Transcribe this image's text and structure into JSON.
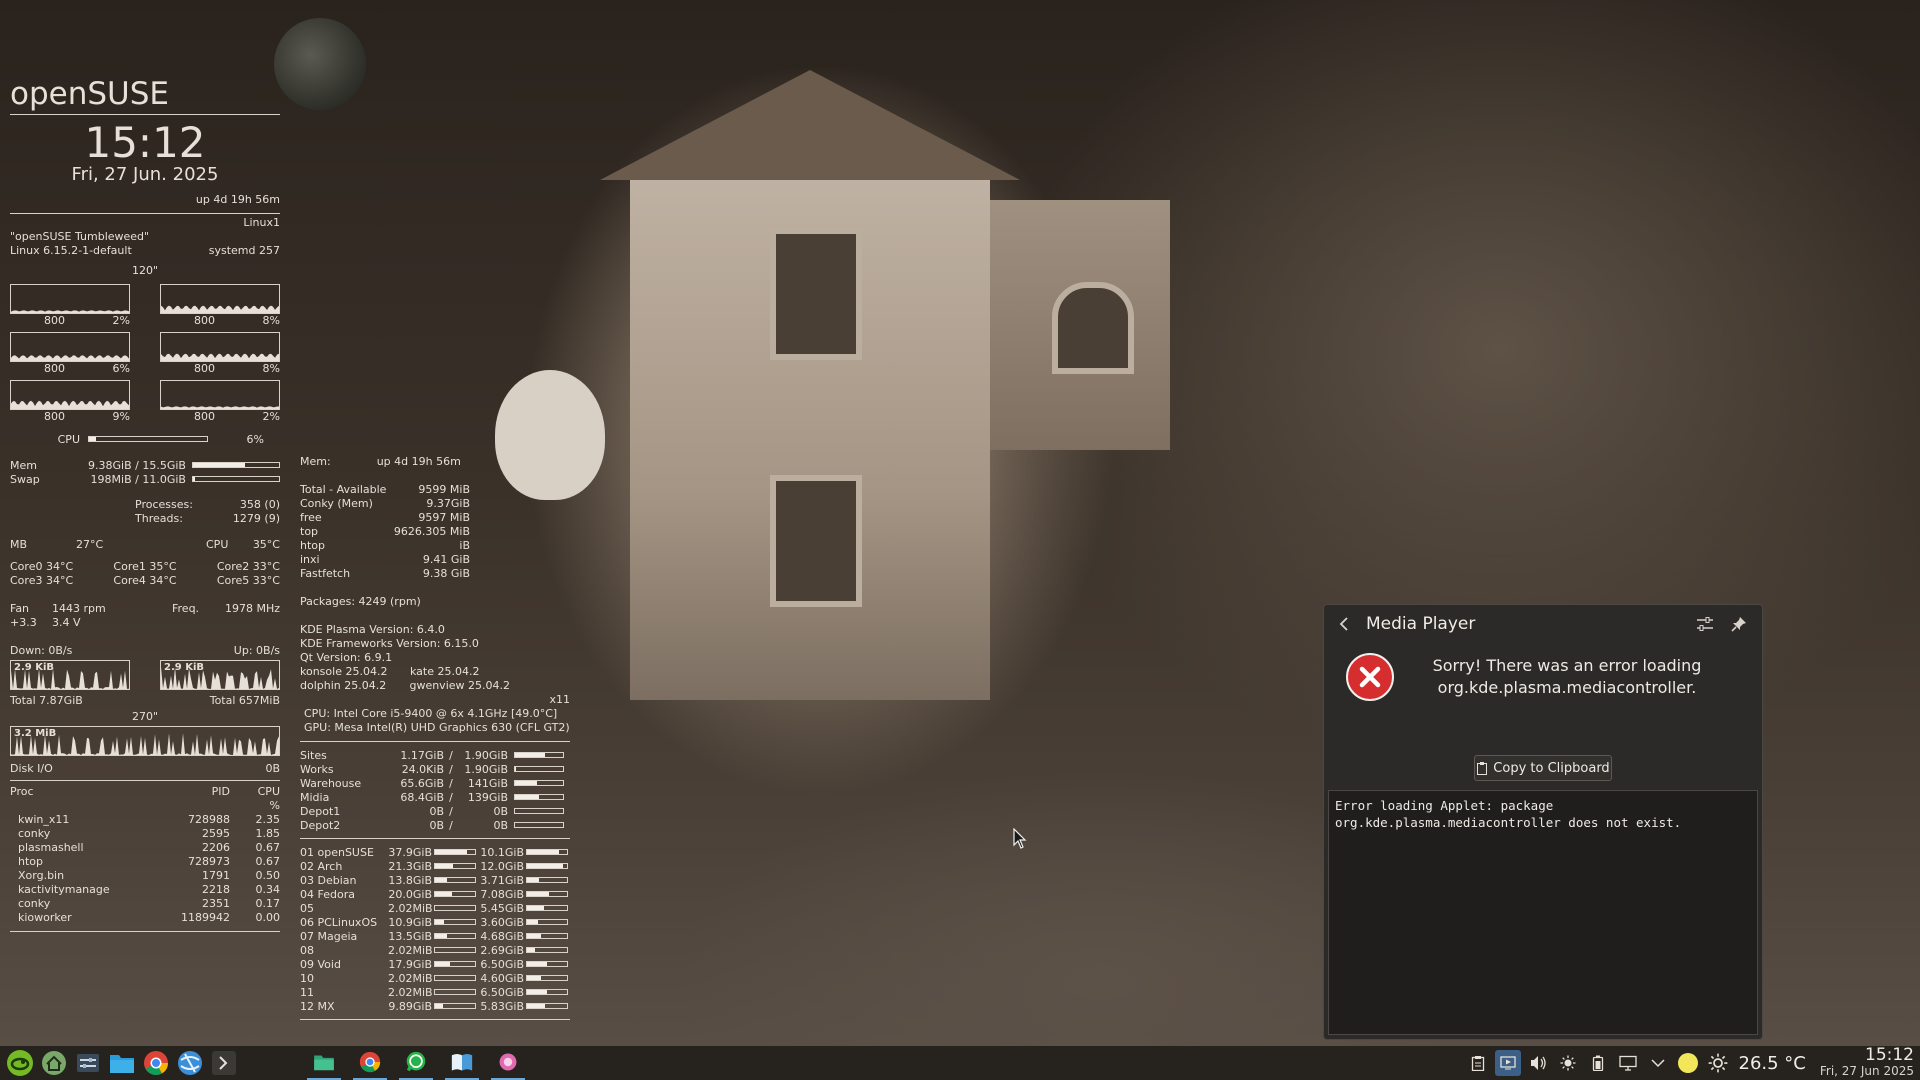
{
  "conky_left": {
    "distro": "openSUSE",
    "time": "15:12",
    "date": "Fri, 27 Jun. 2025",
    "uptime": "up  4d 19h 56m",
    "machine": "Linux1",
    "os_name": "\"openSUSE Tumbleweed\"",
    "kernel": "Linux 6.15.2-1-default",
    "init": "systemd 257",
    "interval": "120\"",
    "cores": [
      {
        "freq": "800",
        "usage": "2%",
        "level": 0.02
      },
      {
        "freq": "800",
        "usage": "8%",
        "level": 0.08
      },
      {
        "freq": "800",
        "usage": "6%",
        "level": 0.06
      },
      {
        "freq": "800",
        "usage": "8%",
        "level": 0.08
      },
      {
        "freq": "800",
        "usage": "9%",
        "level": 0.09
      },
      {
        "freq": "800",
        "usage": "2%",
        "level": 0.02
      }
    ],
    "cpu_label": "CPU",
    "cpu_value": "6%",
    "cpu_level": 0.06,
    "mem_label": "Mem",
    "mem_value": "9.38GiB / 15.5GiB",
    "mem_level": 0.6,
    "swap_label": "Swap",
    "swap_value": "198MiB / 11.0GiB",
    "swap_level": 0.02,
    "processes_label": "Processes:",
    "processes_value": "358 (0)",
    "threads_label": "Threads:",
    "threads_value": "1279 (9)",
    "mb_label": "MB",
    "mb_temp": "27°C",
    "cpu_temp_label": "CPU",
    "cpu_temp": "35°C",
    "core_temps": [
      [
        "Core0  34°C",
        "Core1  35°C",
        "Core2  33°C"
      ],
      [
        "Core3  34°C",
        "Core4  34°C",
        "Core5  33°C"
      ]
    ],
    "fan_label": "Fan",
    "fan_value": "1443 rpm",
    "freq_label": "Freq.",
    "freq_value": "1978  MHz",
    "volt_a": "+3.3",
    "volt_b": "3.4 V",
    "down_label": "Down: 0B/s",
    "up_label": "Up: 0B/s",
    "down_graph_label": "2.9 KiB",
    "up_graph_label": "2.9 KiB",
    "total_down": "Total 7.87GiB",
    "total_up": "Total 657MiB",
    "interval2": "270\"",
    "disk_graph_label": "3.2 MiB",
    "disk_label": "Disk I/O",
    "disk_value": "0B",
    "proc_header": {
      "name": "Proc",
      "pid": "PID",
      "cpu": "CPU",
      "pct": "%"
    },
    "processes": [
      {
        "name": "kwin_x11",
        "pid": "728988",
        "cpu": "2.35"
      },
      {
        "name": "conky",
        "pid": "2595",
        "cpu": "1.85"
      },
      {
        "name": "plasmashell",
        "pid": "2206",
        "cpu": "0.67"
      },
      {
        "name": "htop",
        "pid": "728973",
        "cpu": "0.67"
      },
      {
        "name": "Xorg.bin",
        "pid": "1791",
        "cpu": "0.50"
      },
      {
        "name": "kactivitymanage",
        "pid": "2218",
        "cpu": "0.34"
      },
      {
        "name": "conky",
        "pid": "2351",
        "cpu": "0.17"
      },
      {
        "name": "kioworker",
        "pid": "1189942",
        "cpu": "0.00"
      }
    ]
  },
  "conky_mid": {
    "mem_header": "Mem:",
    "mem_uptime": "up  4d 19h 56m",
    "mem_rows": [
      {
        "label": "Total - Available",
        "value": "9599 MiB"
      },
      {
        "label": "Conky (Mem)",
        "value": "9.37GiB"
      },
      {
        "label": "free",
        "value": "9597   MiB"
      },
      {
        "label": "top",
        "value": "9626.305  MiB"
      },
      {
        "label": "htop",
        "value": "iB"
      },
      {
        "label": "inxi",
        "value": "9.41 GiB"
      },
      {
        "label": "Fastfetch",
        "value": "9.38 GiB"
      }
    ],
    "packages": "Packages: 4249 (rpm)",
    "versions": [
      "KDE Plasma Version: 6.4.0",
      "KDE Frameworks Version: 6.15.0",
      "Qt Version: 6.9.1"
    ],
    "apps": [
      [
        "konsole 25.04.2",
        "kate 25.04.2"
      ],
      [
        "dolphin 25.04.2",
        "gwenview 25.04.2"
      ]
    ],
    "session": "x11",
    "cpu_info": "CPU: Intel Core i5-9400 @ 6x 4.1GHz [49.0°C]",
    "gpu_info": "GPU: Mesa Intel(R) UHD Graphics 630 (CFL GT2)",
    "mounts": [
      {
        "name": "Sites",
        "used": "1.17GiB",
        "total": "1.90GiB",
        "level": 0.62
      },
      {
        "name": "Works",
        "used": "24.0KiB",
        "total": "1.90GiB",
        "level": 0.01
      },
      {
        "name": "Warehouse",
        "used": "65.6GiB",
        "total": "141GiB",
        "level": 0.46
      },
      {
        "name": "Midia",
        "used": "68.4GiB",
        "total": "139GiB",
        "level": 0.49
      },
      {
        "name": "Depot1",
        "used": "0B",
        "total": "0B",
        "level": 0
      },
      {
        "name": "Depot2",
        "used": "0B",
        "total": "0B",
        "level": 0
      }
    ],
    "partitions": [
      {
        "name": "01 openSUSE",
        "a": "37.9GiB",
        "al": 0.8,
        "b": "10.1GiB",
        "bl": 0.8
      },
      {
        "name": "02 Arch",
        "a": "21.3GiB",
        "al": 0.45,
        "b": "12.0GiB",
        "bl": 0.9
      },
      {
        "name": "03 Debian",
        "a": "13.8GiB",
        "al": 0.3,
        "b": "3.71GiB",
        "bl": 0.3
      },
      {
        "name": "04 Fedora",
        "a": "20.0GiB",
        "al": 0.42,
        "b": "7.08GiB",
        "bl": 0.55
      },
      {
        "name": "05",
        "a": "2.02MiB",
        "al": 0.0,
        "b": "5.45GiB",
        "bl": 0.42
      },
      {
        "name": "06 PCLinuxOS",
        "a": "10.9GiB",
        "al": 0.23,
        "b": "3.60GiB",
        "bl": 0.28
      },
      {
        "name": "07 Mageia",
        "a": "13.5GiB",
        "al": 0.29,
        "b": "4.68GiB",
        "bl": 0.36
      },
      {
        "name": "08",
        "a": "2.02MiB",
        "al": 0.0,
        "b": "2.69GiB",
        "bl": 0.2
      },
      {
        "name": "09 Void",
        "a": "17.9GiB",
        "al": 0.38,
        "b": "6.50GiB",
        "bl": 0.5
      },
      {
        "name": "10",
        "a": "2.02MiB",
        "al": 0.0,
        "b": "4.60GiB",
        "bl": 0.35
      },
      {
        "name": "11",
        "a": "2.02MiB",
        "al": 0.0,
        "b": "6.50GiB",
        "bl": 0.5
      },
      {
        "name": "12 MX",
        "a": "9.89GiB",
        "al": 0.21,
        "b": "5.83GiB",
        "bl": 0.45
      }
    ]
  },
  "media_player": {
    "title": "Media Player",
    "error_line1": "Sorry! There was an error loading",
    "error_line2": "org.kde.plasma.mediacontroller.",
    "copy_button": "Copy to Clipboard",
    "error_detail": "Error loading Applet: package\norg.kde.plasma.mediacontroller does not exist."
  },
  "taskbar": {
    "temperature": "26.5 °C",
    "clock_time": "15:12",
    "clock_date": "Fri, 27 Jun 2025"
  },
  "colors": {
    "error_red": "#d62e2e",
    "panel_bg": "#2c2a28",
    "taskbar_bg": "#221e1b"
  }
}
